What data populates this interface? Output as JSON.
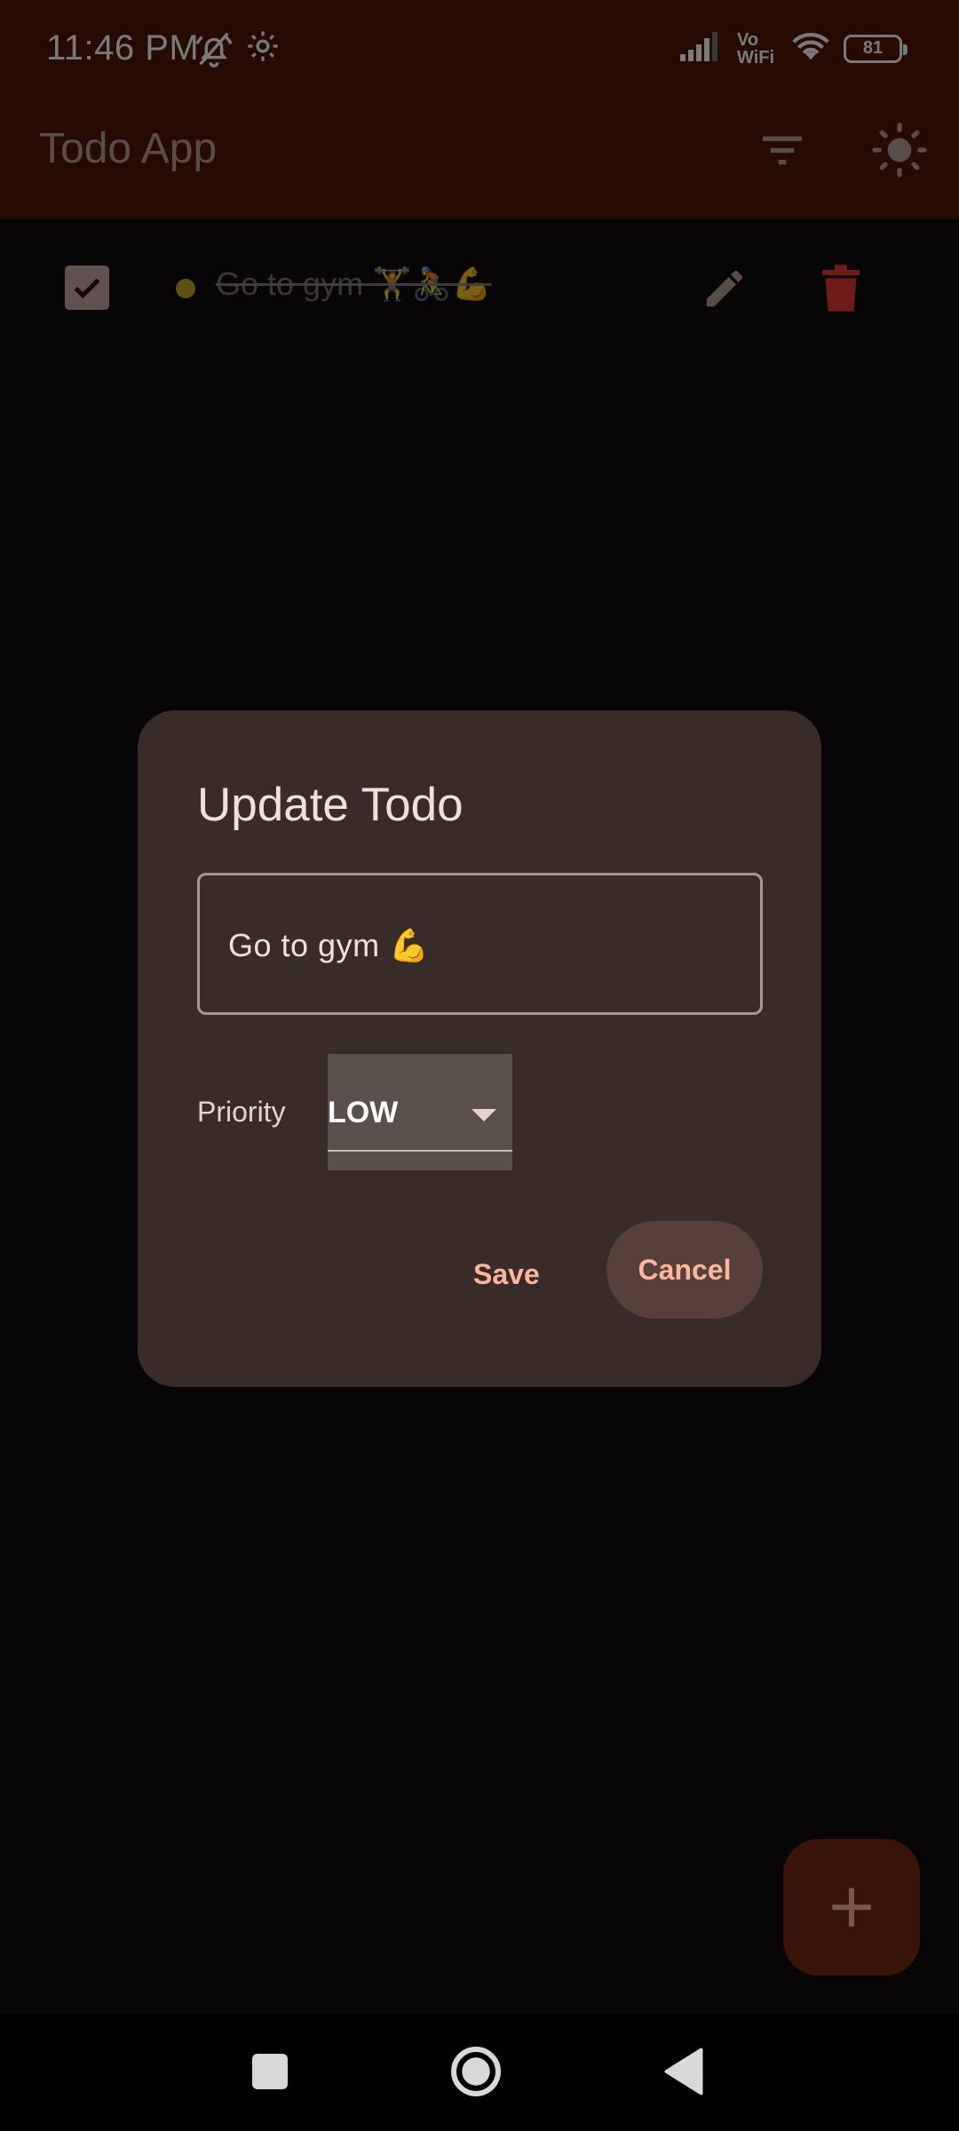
{
  "status_bar": {
    "time": "11:46 PM",
    "network": "Vo WiFi",
    "battery": "81"
  },
  "app_bar": {
    "title": "Todo App",
    "icons": [
      "filter-icon",
      "brightness-icon"
    ]
  },
  "todos": [
    {
      "text": "Go to gym 🏋️🚴💪",
      "completed": true,
      "priority_color": "#c9a928"
    }
  ],
  "dialog": {
    "title": "Update Todo",
    "input_value": "Go to gym 💪",
    "priority_label": "Priority",
    "priority_value": "LOW",
    "save_label": "Save",
    "cancel_label": "Cancel"
  },
  "fab": {
    "label": "+"
  },
  "colors": {
    "app_bar": "#521600",
    "dialog_surface": "#392c28",
    "accent": "#ffb59c",
    "delete": "#c0392b"
  }
}
